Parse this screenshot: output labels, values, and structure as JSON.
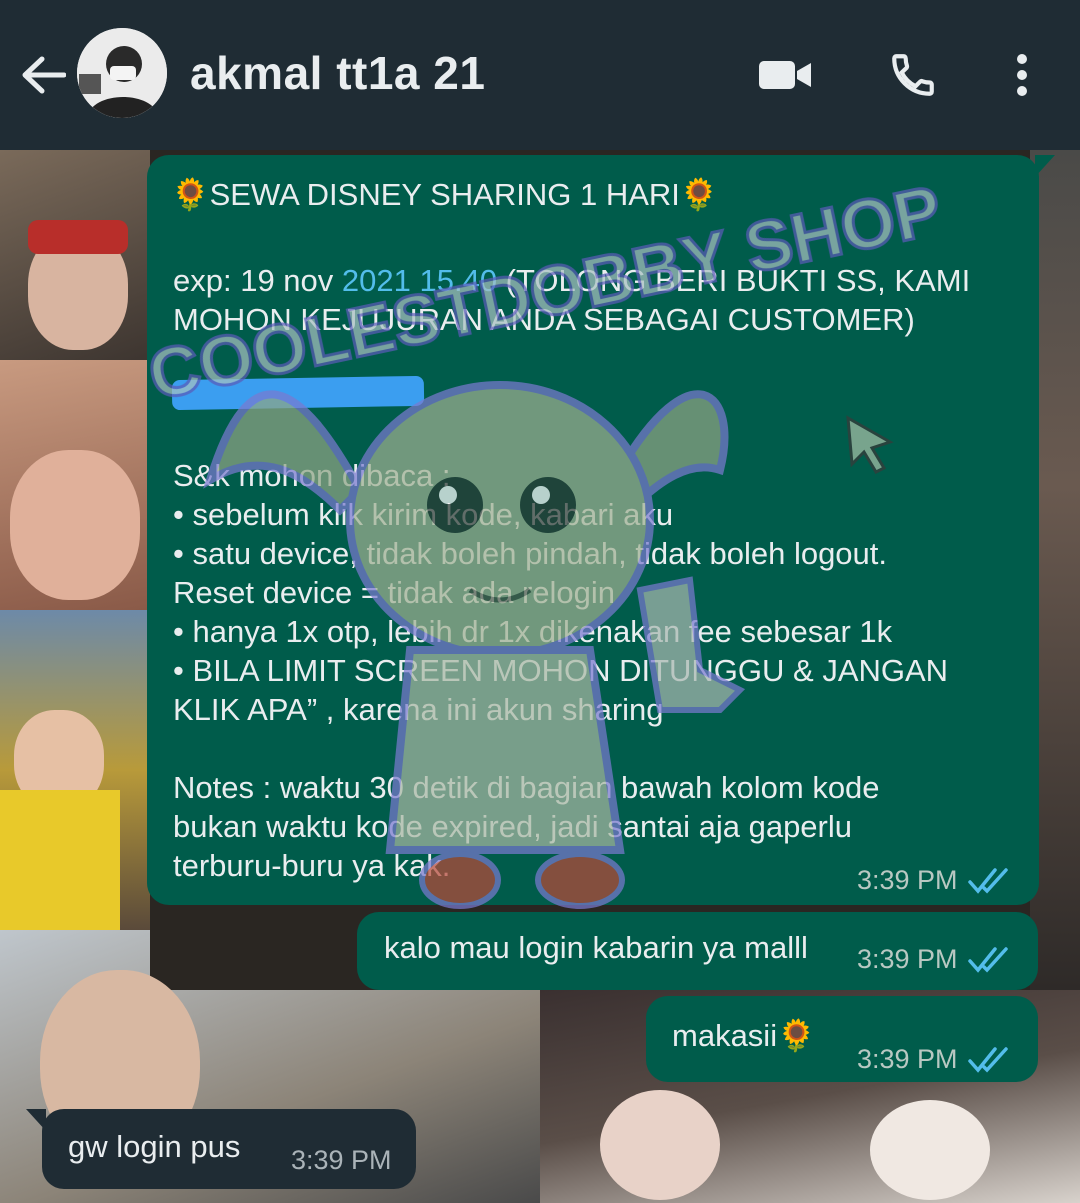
{
  "header": {
    "back_icon": "arrow-left-icon",
    "contact_name": "akmal tt1a 21",
    "video_call_icon": "video-camera-icon",
    "voice_call_icon": "phone-icon",
    "menu_icon": "more-vertical-icon",
    "background": "#1f2c34"
  },
  "messages": [
    {
      "direction": "outgoing",
      "title": "SEWA DISNEY SHARING 1 HARI",
      "lines": {
        "exp_prefix": "exp: 19 nov  ",
        "exp_link": "2021 15.40",
        "exp_suffix": " (TOLONG BERI BUKTI SS, KAMI",
        "line3": "MOHON KEJUJURAN ANDA SEBAGAI CUSTOMER)",
        "line4": "S&k mohon dibaca :",
        "line5": "• sebelum klik kirim kode, kabari aku",
        "line6": "• satu device, tidak boleh pindah, tidak boleh logout.",
        "line7": "Reset device = tidak ada relogin",
        "line8": "• hanya 1x otp, lebih dr 1x dikenakan fee sebesar 1k",
        "line9": "• BILA LIMIT SCREEN MOHON DITUNGGU & JANGAN",
        "line10": "KLIK APA” , karena ini akun sharing",
        "line11": "Notes : waktu 30 detik di bagian bawah kolom kode",
        "line12": "bukan waktu kode expired, jadi santai aja gaperlu",
        "line13": "terburu-buru ya kak."
      },
      "time": "3:39 PM",
      "status_icon": "double-check-read-icon"
    },
    {
      "direction": "outgoing",
      "text": "kalo mau login kabarin ya malll",
      "time": "3:39 PM",
      "status_icon": "double-check-read-icon"
    },
    {
      "direction": "outgoing",
      "text": "makasii",
      "time": "3:39 PM",
      "status_icon": "double-check-read-icon"
    },
    {
      "direction": "incoming",
      "text": "gw login pus",
      "time": "3:39 PM"
    }
  ],
  "watermark": {
    "text": "COOLESTDOBBY SHOP",
    "icon": "cursor-arrow-icon",
    "mascot_icon": "house-elf-mascot-icon"
  },
  "colors": {
    "outgoing_bubble": "#005c4b",
    "incoming_bubble": "#1f2c34",
    "link": "#53bdeb",
    "read_ticks": "#53bdeb",
    "redaction": "#3b9ef0"
  }
}
